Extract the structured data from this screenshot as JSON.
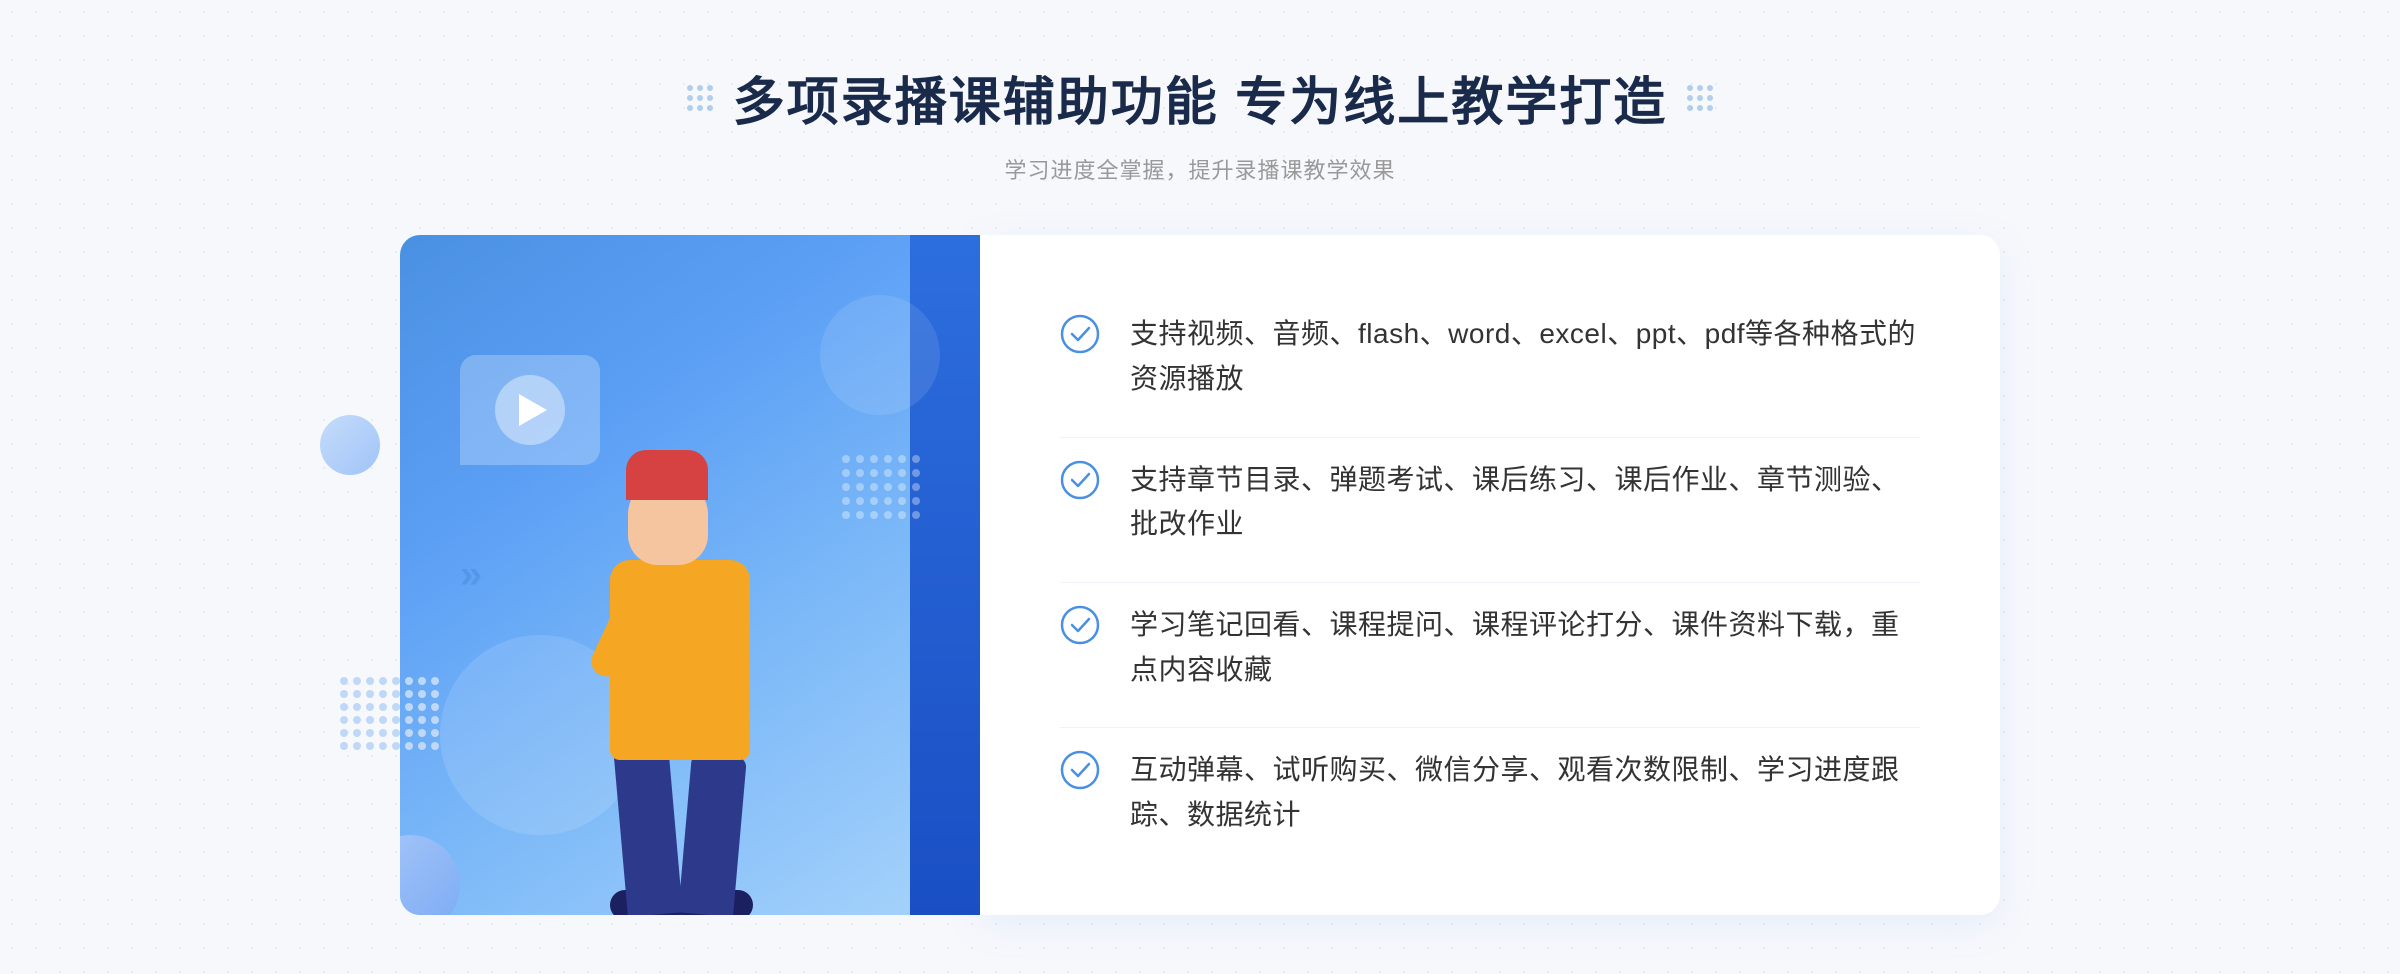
{
  "header": {
    "title": "多项录播课辅助功能 专为线上教学打造",
    "subtitle": "学习进度全掌握，提升录播课教学效果",
    "decorative_dots_left": "left-dots",
    "decorative_dots_right": "right-dots"
  },
  "features": [
    {
      "id": 1,
      "text": "支持视频、音频、flash、word、excel、ppt、pdf等各种格式的资源播放"
    },
    {
      "id": 2,
      "text": "支持章节目录、弹题考试、课后练习、课后作业、章节测验、批改作业"
    },
    {
      "id": 3,
      "text": "学习笔记回看、课程提问、课程评论打分、课件资料下载，重点内容收藏"
    },
    {
      "id": 4,
      "text": "互动弹幕、试听购买、微信分享、观看次数限制、学习进度跟踪、数据统计"
    }
  ],
  "colors": {
    "blue_primary": "#4a90e2",
    "blue_dark": "#2d6ede",
    "title_dark": "#1a2a4a",
    "text_gray": "#333333",
    "subtitle_gray": "#999999"
  },
  "left_chevron": "«",
  "stripe_rows": 6,
  "stripe_cols": 8
}
